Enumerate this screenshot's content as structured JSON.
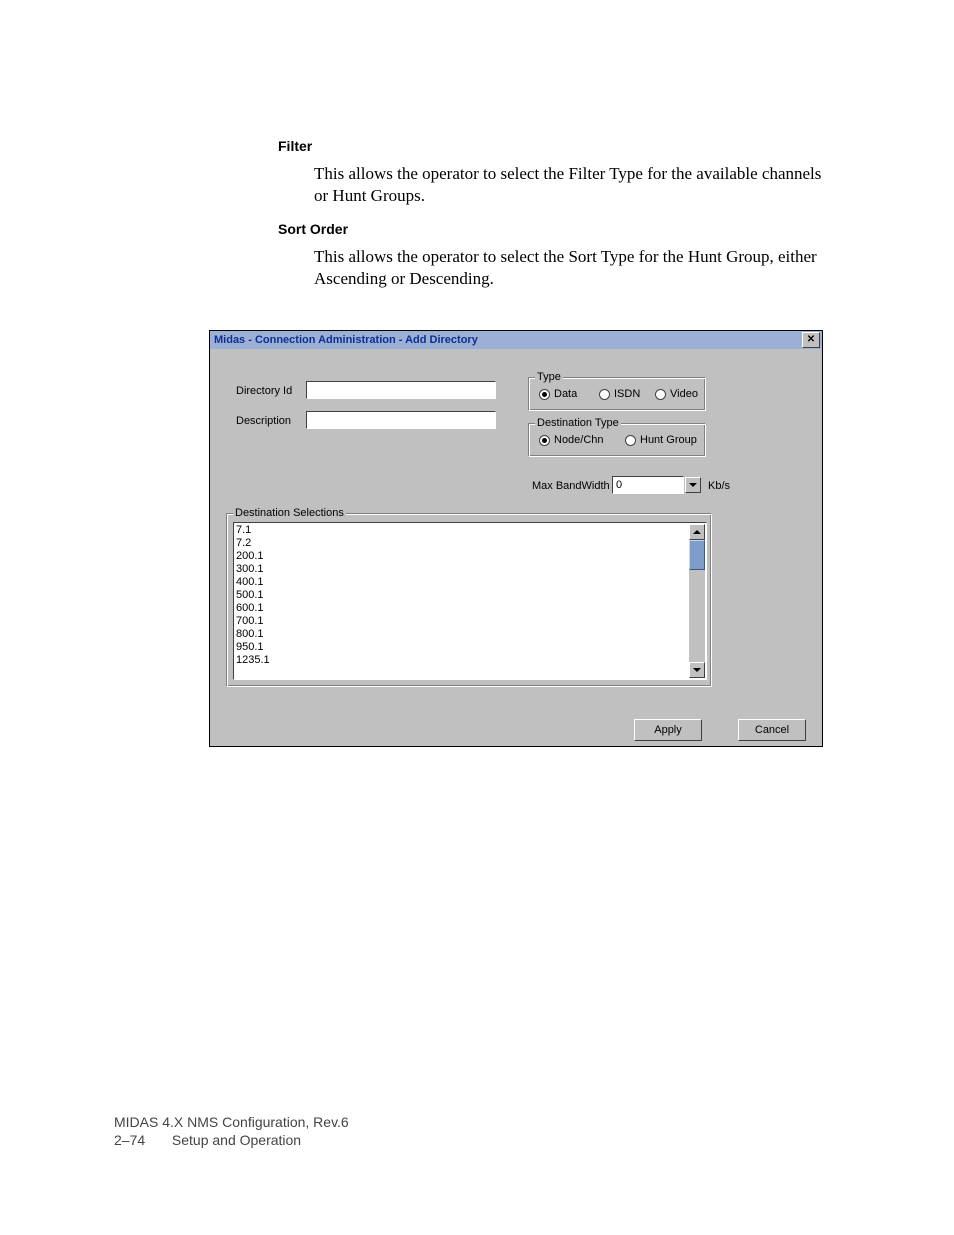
{
  "sections": {
    "filter": {
      "heading": "Filter",
      "text": "This allows the operator to select the Filter Type for the available channels or Hunt Groups."
    },
    "sort_order": {
      "heading": "Sort Order",
      "text": "This allows the operator to select the Sort Type for the Hunt Group, either Ascending or Descending."
    }
  },
  "dialog": {
    "title": "Midas - Connection Administration - Add Directory",
    "labels": {
      "directory_id": "Directory Id",
      "description": "Description",
      "type_group": "Type",
      "type_data": "Data",
      "type_isdn": "ISDN",
      "type_video": "Video",
      "dest_type_group": "Destination Type",
      "dest_nodechn": "Node/Chn",
      "dest_hunt": "Hunt Group",
      "max_bw": "Max BandWidth",
      "max_bw_unit": "Kb/s",
      "dest_sel_group": "Destination Selections"
    },
    "values": {
      "directory_id": "",
      "description": "",
      "max_bw": "0"
    },
    "radios": {
      "type": "data",
      "dest": "nodechn"
    },
    "dest_list": [
      "7.1",
      "7.2",
      "200.1",
      "300.1",
      "400.1",
      "500.1",
      "600.1",
      "700.1",
      "800.1",
      "950.1",
      "1235.1"
    ],
    "buttons": {
      "apply": "Apply",
      "cancel": "Cancel"
    }
  },
  "footer": {
    "line1": "MIDAS 4.X NMS Configuration, Rev.6",
    "page_no": "2–74",
    "section": "Setup and Operation"
  }
}
